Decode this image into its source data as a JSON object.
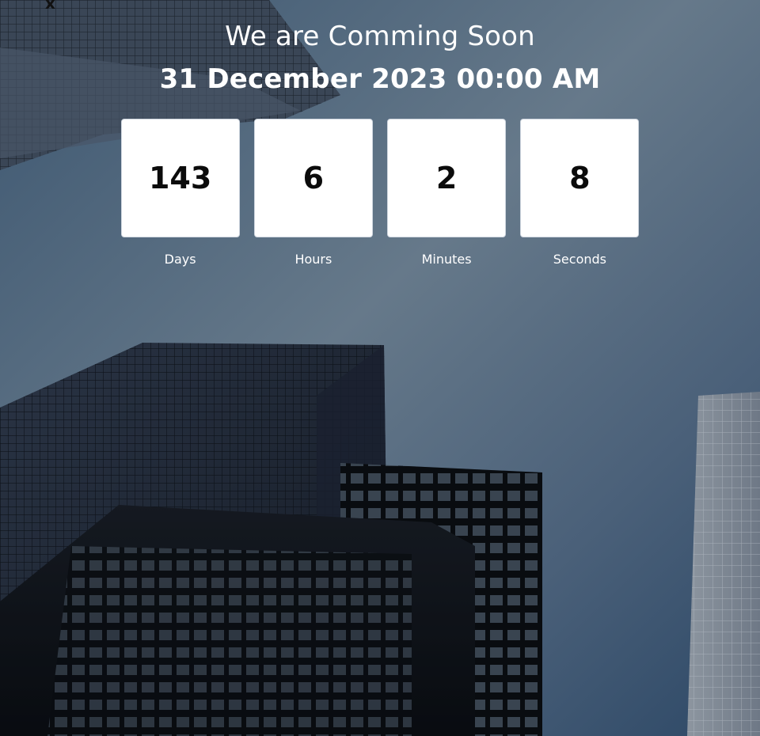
{
  "page": {
    "close_symbol": "x",
    "title": "We are Comming Soon",
    "date": "31 December 2023 00:00 AM"
  },
  "countdown": [
    {
      "value": "143",
      "label": "Days"
    },
    {
      "value": "6",
      "label": "Hours"
    },
    {
      "value": "2",
      "label": "Minutes"
    },
    {
      "value": "8",
      "label": "Seconds"
    }
  ],
  "colors": {
    "sky_top": "#33506f",
    "sky_mid": "#5d7386",
    "tile_background": "#ffffff",
    "number_text": "#0b0b0b",
    "label_text": "#ffffff"
  },
  "background": {
    "subject": "low-angle view of city skyscrapers against a blue sky"
  }
}
